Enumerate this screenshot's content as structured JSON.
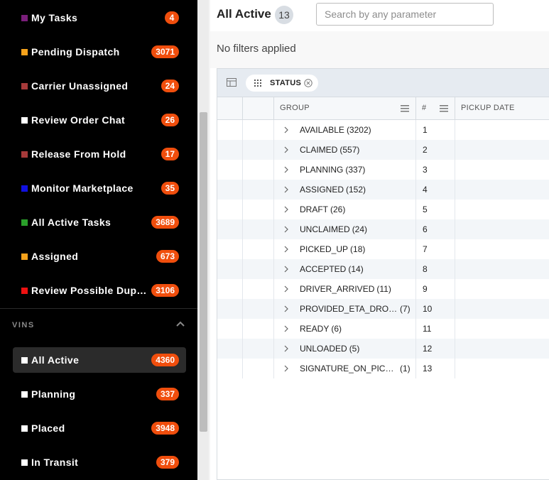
{
  "sidebar": {
    "tasks": [
      {
        "label": "My Tasks",
        "badge": "4",
        "color": "#7a1f7a"
      },
      {
        "label": "Pending Dispatch",
        "badge": "3071",
        "color": "#f5a21b"
      },
      {
        "label": "Carrier Unassigned",
        "badge": "24",
        "color": "#a63a3a"
      },
      {
        "label": "Review Order Chat",
        "badge": "26",
        "color": "#ffffff"
      },
      {
        "label": "Release From Hold",
        "badge": "17",
        "color": "#a63a3a"
      },
      {
        "label": "Monitor Marketplace",
        "badge": "35",
        "color": "#1010e0"
      },
      {
        "label": "All Active Tasks",
        "badge": "3689",
        "color": "#2aa02a"
      },
      {
        "label": "Assigned",
        "badge": "673",
        "color": "#f5a21b"
      },
      {
        "label": "Review Possible Duplicates",
        "badge": "3106",
        "color": "#ee1111"
      }
    ],
    "section_label": "VINS",
    "vins": [
      {
        "label": "All Active",
        "badge": "4360",
        "color": "#ffffff",
        "active": true
      },
      {
        "label": "Planning",
        "badge": "337",
        "color": "#ffffff"
      },
      {
        "label": "Placed",
        "badge": "3948",
        "color": "#ffffff"
      },
      {
        "label": "In Transit",
        "badge": "379",
        "color": "#ffffff"
      }
    ]
  },
  "main": {
    "title": "All Active",
    "title_count": "13",
    "search_placeholder": "Search by any parameter",
    "filters_text": "No filters applied",
    "group_chip": "STATUS",
    "columns": {
      "group": "GROUP",
      "num": "#",
      "pickup": "PICKUP DATE"
    },
    "rows": [
      {
        "label": "AVAILABLE",
        "count": "(3202)",
        "num": "1"
      },
      {
        "label": "CLAIMED",
        "count": "(557)",
        "num": "2"
      },
      {
        "label": "PLANNING",
        "count": "(337)",
        "num": "3"
      },
      {
        "label": "ASSIGNED",
        "count": "(152)",
        "num": "4"
      },
      {
        "label": "DRAFT",
        "count": "(26)",
        "num": "5"
      },
      {
        "label": "UNCLAIMED",
        "count": "(24)",
        "num": "6"
      },
      {
        "label": "PICKED_UP",
        "count": "(18)",
        "num": "7"
      },
      {
        "label": "ACCEPTED",
        "count": "(14)",
        "num": "8"
      },
      {
        "label": "DRIVER_ARRIVED",
        "count": "(11)",
        "num": "9"
      },
      {
        "label": "PROVIDED_ETA_DROPOFF",
        "count": "(7)",
        "num": "10"
      },
      {
        "label": "READY",
        "count": "(6)",
        "num": "11"
      },
      {
        "label": "UNLOADED",
        "count": "(5)",
        "num": "12"
      },
      {
        "label": "SIGNATURE_ON_PICKUP",
        "count": "(1)",
        "num": "13"
      }
    ]
  },
  "colors": {
    "badge": "#f04e0d",
    "sidebar_bg": "#000000",
    "header_bg": "#e6ebf1"
  },
  "icons": {
    "grip": "drag-handle-icon",
    "close": "close-circle-icon",
    "caret": "chevron-right-icon",
    "menu": "column-menu-icon",
    "collapse": "chevron-up-icon"
  }
}
